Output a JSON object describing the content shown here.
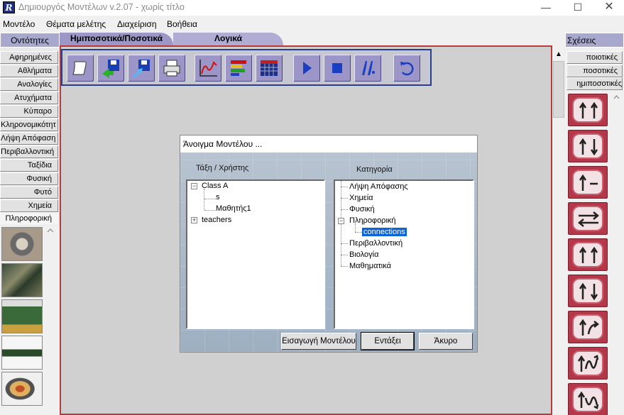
{
  "window": {
    "title": "Δημιουργός Μοντέλων v.2.07 - χωρίς τίτλο",
    "icon_letter": "R",
    "minimize_symbol": "—",
    "maximize_symbol": "☐",
    "close_symbol": "✕"
  },
  "menu": [
    "Μοντέλο",
    "Θέματα μελέτης",
    "Διαχείριση",
    "Βοήθεια"
  ],
  "left_panel": {
    "header": "Οντότητες",
    "items": [
      "Αφηρημένες",
      "Αθλήματα",
      "Αναλογίες",
      "Ατυχήματα",
      "Κύπαρο",
      "Κληρονομικότητ",
      "Λήψη Απόφαση",
      "Περιβαλλοντική",
      "Ταξίδια",
      "Φυσική",
      "Φυτό",
      "Χημεία",
      "Πληροφορική"
    ],
    "selected_index": 12,
    "thumbnails": [
      "cpu-chip-thumbnail",
      "motherboard-thumbnail",
      "expansion-card-thumbnail",
      "ram-module-thumbnail",
      "hard-disk-thumbnail"
    ]
  },
  "tabs": [
    "Ημιποσοτικά/Ποσοτικά",
    "Λογικά"
  ],
  "toolbar": {
    "buttons": [
      "new-document",
      "open-model",
      "save-model",
      "print",
      "line-graph",
      "bar-chart",
      "table",
      "play",
      "stop",
      "step",
      "reset"
    ]
  },
  "right_panel": {
    "header": "Σχέσεις",
    "items": [
      "ποιοτικές",
      "ποσοτικές",
      "ημιποσοτικές"
    ],
    "relations": [
      "increase-increase",
      "increase-decrease",
      "increase-constant",
      "bidirectional",
      "increase-increase-2",
      "decrease-decrease",
      "increase-curve-up",
      "increase-wave-up",
      "increase-wave-down"
    ]
  },
  "dialog": {
    "title": "Άνοιγμα Μοντέλου ...",
    "left_label": "Τάξη / Χρήστης",
    "right_label": "Κατηγορία",
    "users_tree": [
      {
        "label": "Class A",
        "level": 0,
        "expander": "−"
      },
      {
        "label": "s",
        "level": 1
      },
      {
        "label": "Μαθητής1",
        "level": 1
      },
      {
        "label": "teachers",
        "level": 0,
        "expander": "+"
      }
    ],
    "category_tree": [
      {
        "label": "Λήψη Απόφασης",
        "level": 0
      },
      {
        "label": "Χημεία",
        "level": 0
      },
      {
        "label": "Φυσική",
        "level": 0
      },
      {
        "label": "Πληροφορική",
        "level": 0,
        "expander": "−"
      },
      {
        "label": "connections",
        "level": 1,
        "selected": true
      },
      {
        "label": "Περιβαλλοντική",
        "level": 0
      },
      {
        "label": "Βιολογία",
        "level": 0
      },
      {
        "label": "Μαθηματικά",
        "level": 0
      }
    ],
    "buttons": {
      "import": "Εισαγωγή Μοντέλου",
      "ok": "Εντάξει",
      "cancel": "Άκυρο"
    }
  },
  "colors": {
    "accent_border": "#b83a3a",
    "relation_button": "#b5374a",
    "tab_active": "#9d97c8",
    "selection": "#0a64d8"
  }
}
